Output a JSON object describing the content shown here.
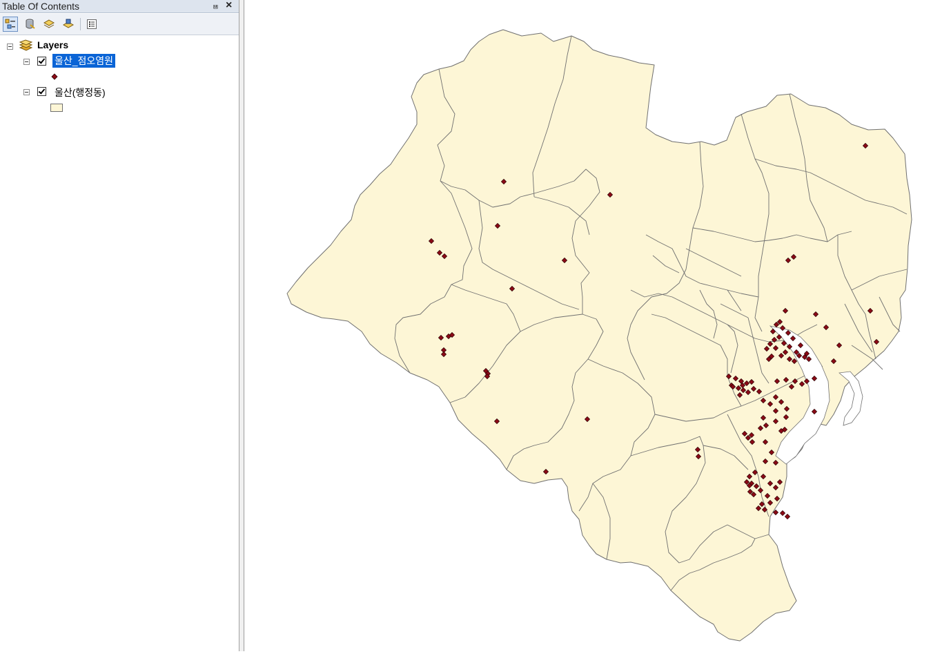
{
  "toc": {
    "title": "Table Of Contents",
    "pin_glyph": "⩏",
    "close_glyph": "×",
    "toolbar": [
      "list-by-drawing-order-icon",
      "list-by-source-icon",
      "list-by-visibility-icon",
      "list-by-selection-icon",
      "options-icon"
    ],
    "root": {
      "label": "Layers",
      "expanded": true
    },
    "layers": [
      {
        "label": "울산_점오염원",
        "checked": true,
        "selected": true,
        "symbol": "point",
        "symbol_color": "#8b0a16"
      },
      {
        "label": "울산(행정동)",
        "checked": true,
        "selected": false,
        "symbol": "polygon",
        "symbol_color": "#fdf6d6"
      }
    ]
  },
  "map": {
    "polygon_fill": "#fdf6d6",
    "polygon_stroke": "#6f6f6f",
    "point_fill": "#8b0a16",
    "point_stroke": "#2a0003"
  }
}
